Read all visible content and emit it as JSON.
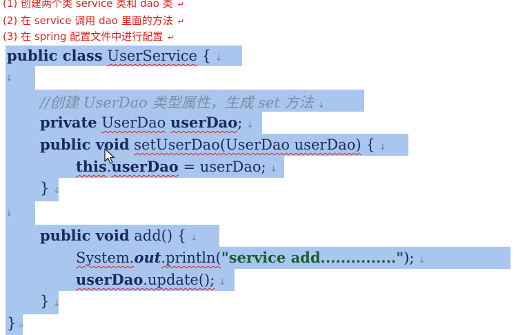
{
  "steps": [
    {
      "num": "(1)",
      "text": "创建两个类 service 类和 dao 类"
    },
    {
      "num": "(2)",
      "text": "在 service 调用 dao 里面的方法"
    },
    {
      "num": "(3)",
      "text": "在 spring 配置文件中进行配置"
    }
  ],
  "code": {
    "line1": {
      "kw": "public class",
      "name": "UserService",
      "brace": "{"
    },
    "comment": "//创建 UserDao 类型属性，生成 set 方法",
    "field": {
      "kw": "private",
      "type": "UserDao",
      "name": "userDao",
      "end": ";"
    },
    "setter": {
      "kw": "public void",
      "name": "setUserDao",
      "params": "(UserDao userDao)",
      "brace": "{"
    },
    "assign": {
      "kw": "this",
      "dot": ".",
      "field": "userDao",
      "rest": " = userDao;"
    },
    "close_brace": "}",
    "add_sig": {
      "kw": "public void",
      "name": "add()",
      "brace": "{"
    },
    "println": {
      "obj": "System.",
      "field": "out",
      "call": ".println(",
      "str": "\"service add...............\"",
      "end": ");"
    },
    "update": {
      "obj": "userDao",
      "call": ".update();"
    },
    "final_brace": "}"
  },
  "marks": {
    "para": "↵",
    "arrow": "↓"
  }
}
